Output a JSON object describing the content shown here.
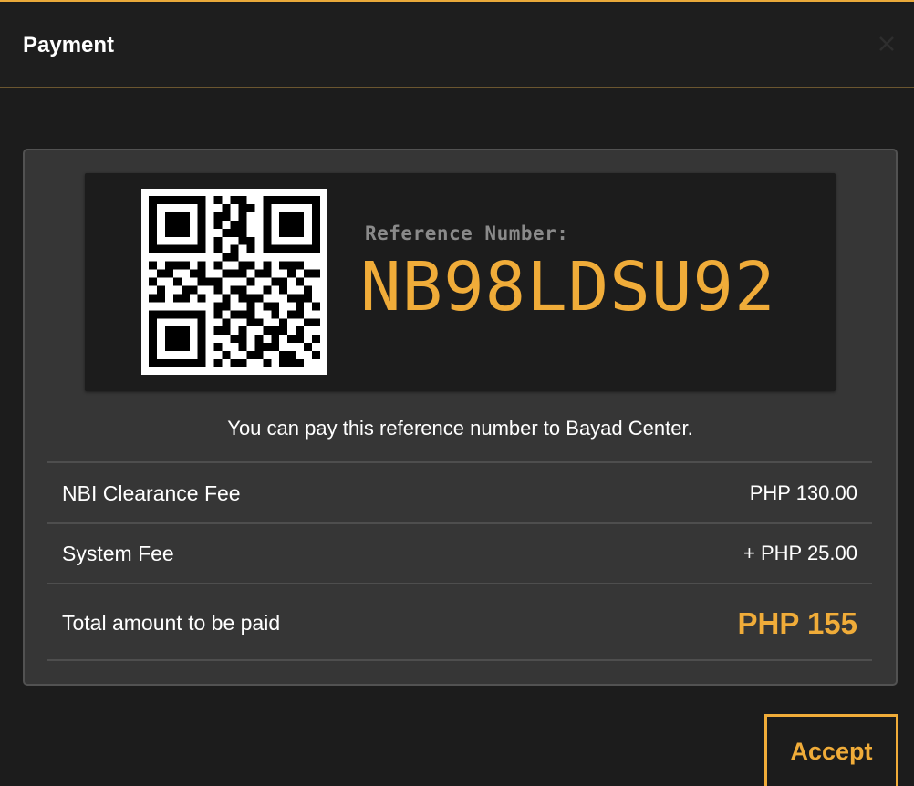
{
  "modal": {
    "title": "Payment"
  },
  "reference": {
    "label": "Reference Number:",
    "number": "NB98LDSU92"
  },
  "note": "You can pay this reference number to Bayad Center.",
  "fees": [
    {
      "label": "NBI Clearance Fee",
      "value": "PHP 130.00"
    },
    {
      "label": "System Fee",
      "value": "+ PHP 25.00"
    }
  ],
  "total": {
    "label": "Total amount to be paid",
    "value": "PHP 155"
  },
  "actions": {
    "accept_label": "Accept"
  },
  "icons": {
    "close": "close-icon",
    "qr": "qr-code-icon"
  },
  "colors": {
    "accent": "#f0ac39",
    "background": "#1c1c1c",
    "card": "#363636"
  }
}
